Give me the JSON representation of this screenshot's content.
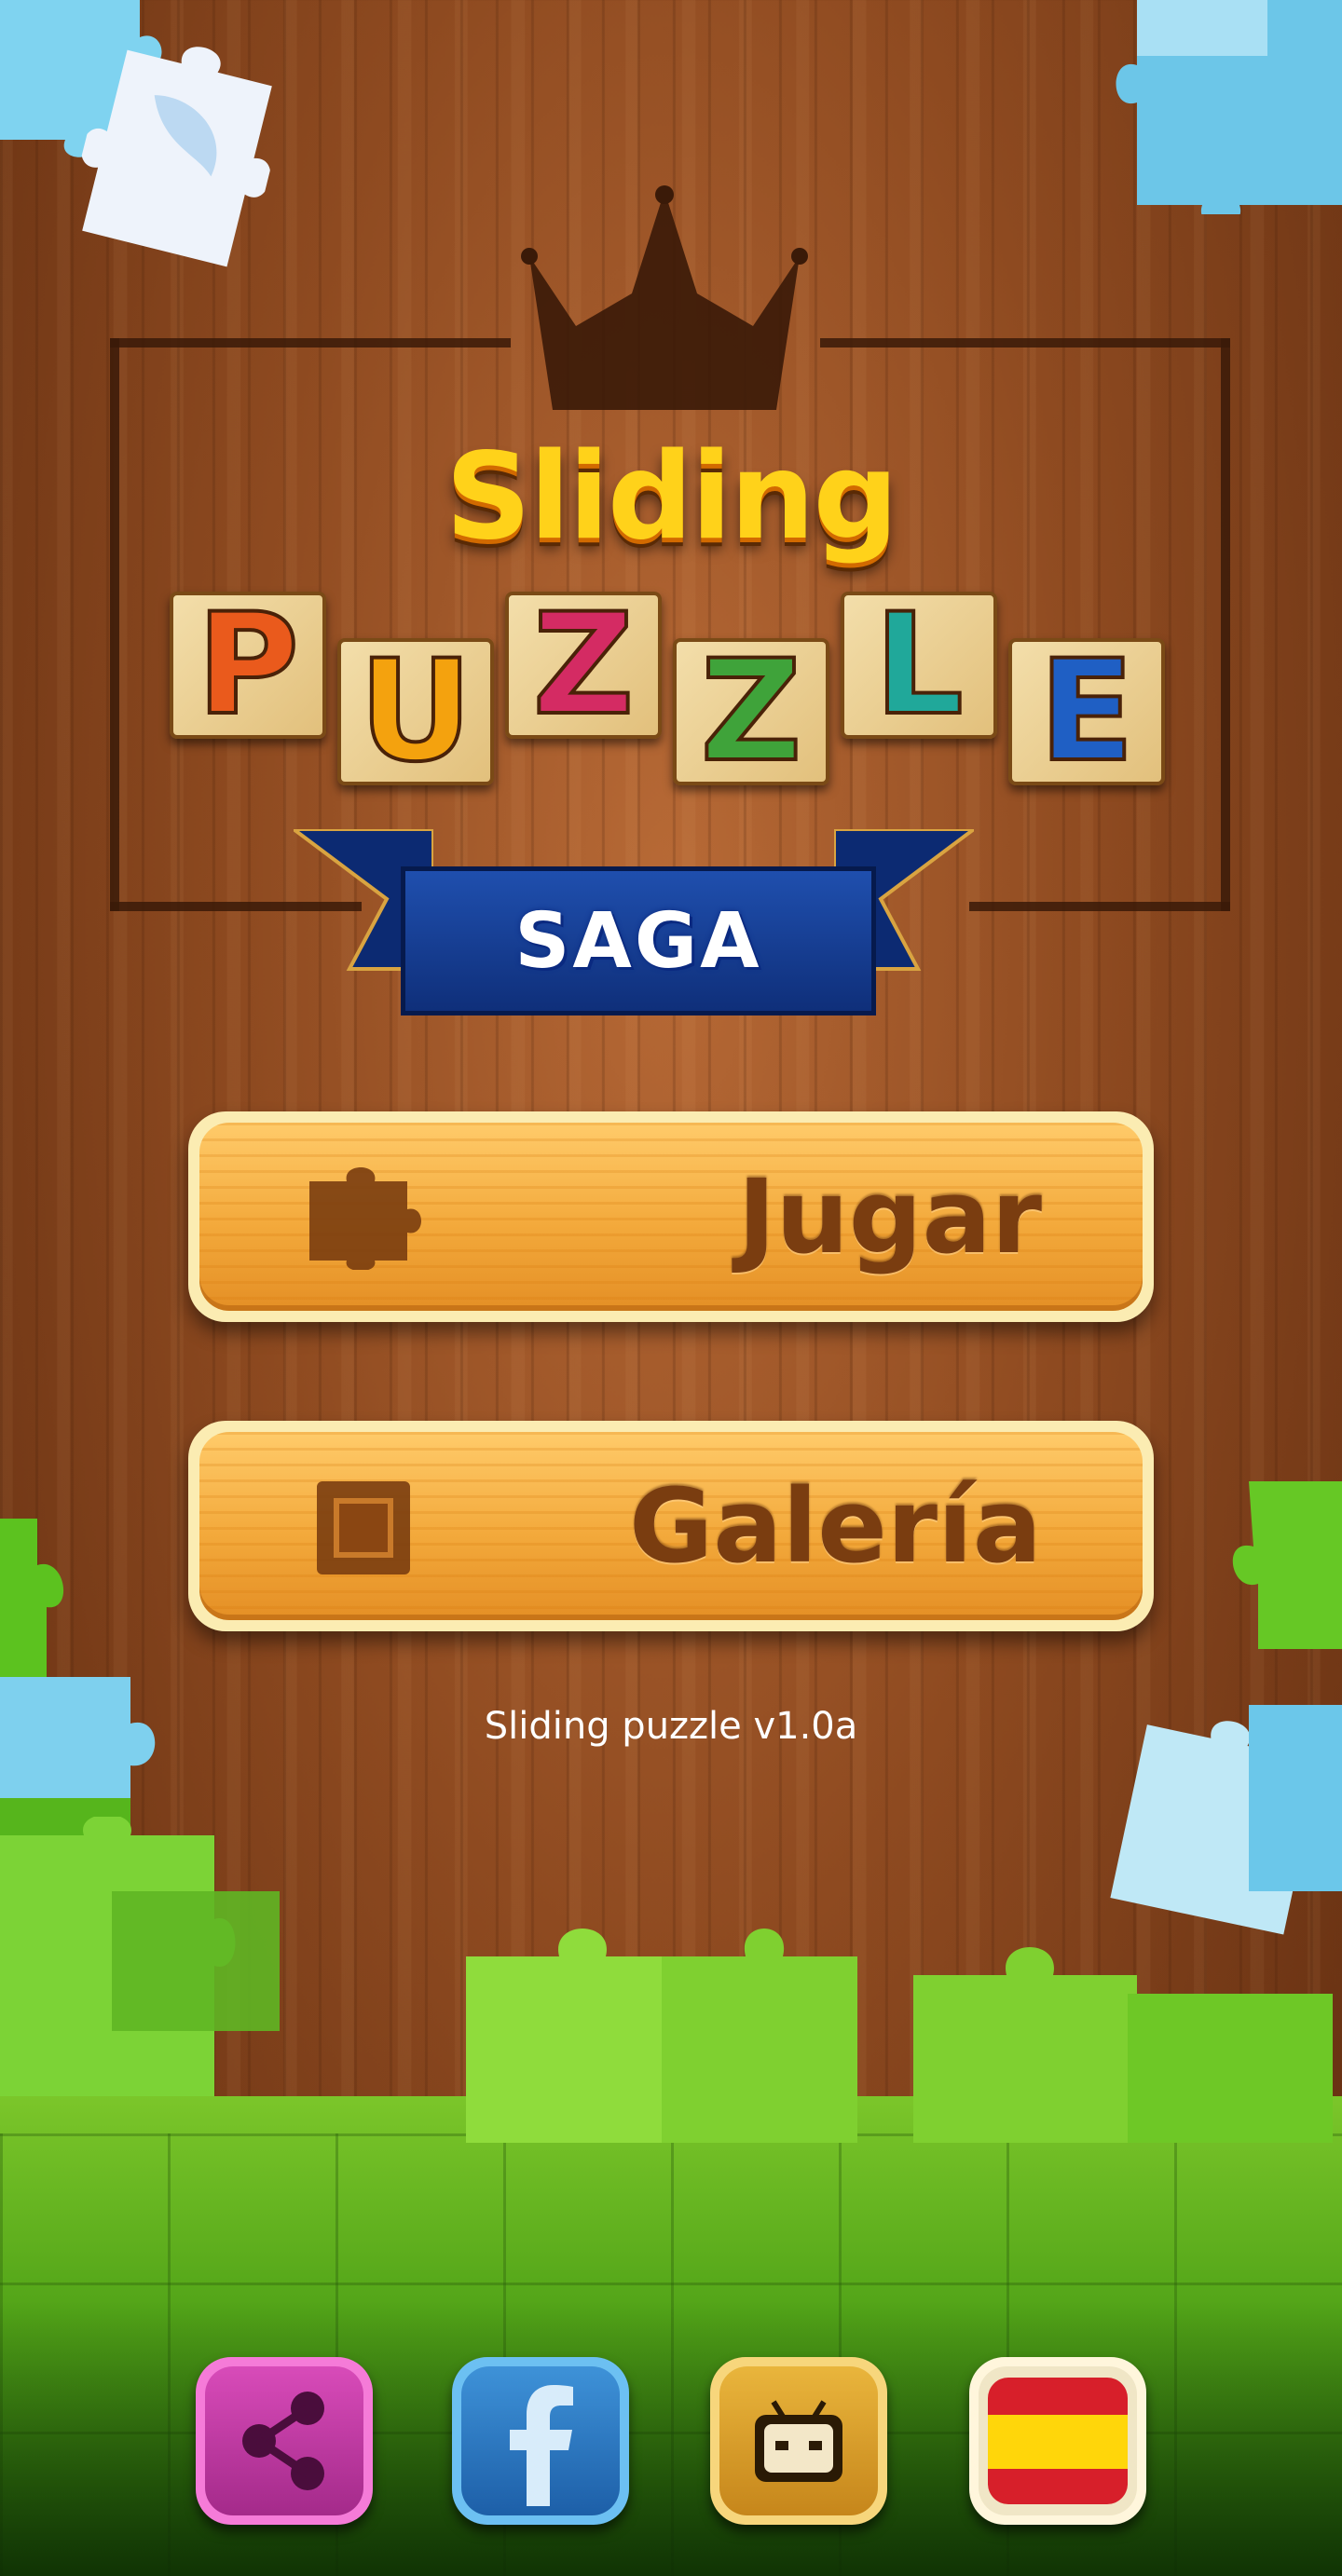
{
  "logo": {
    "word1": "Sliding",
    "letters": [
      {
        "char": "P",
        "color": "#ea5a1c"
      },
      {
        "char": "U",
        "color": "#f4a20e"
      },
      {
        "char": "Z",
        "color": "#d42b63"
      },
      {
        "char": "Z",
        "color": "#3fa33a"
      },
      {
        "char": "L",
        "color": "#20a89a"
      },
      {
        "char": "E",
        "color": "#1f5fc4"
      }
    ],
    "banner": "SAGA"
  },
  "menu": {
    "play_label": "Jugar",
    "gallery_label": "Galería"
  },
  "version_text": "Sliding puzzle v1.0a",
  "bottom_bar": {
    "share_icon": "share-icon",
    "facebook_icon": "facebook-icon",
    "more_games_icon": "robot-icon",
    "language_icon": "spain-flag-icon",
    "share_color": "#c43aa6",
    "facebook_color": "#2f7fc8",
    "more_games_color": "#e3a52c",
    "language_color": "#f0e6c6"
  },
  "colors": {
    "wood_dark": "#5e2b0f",
    "wood_light": "#b86a36",
    "button_text": "#7a3d10",
    "grass": "#52a418"
  }
}
